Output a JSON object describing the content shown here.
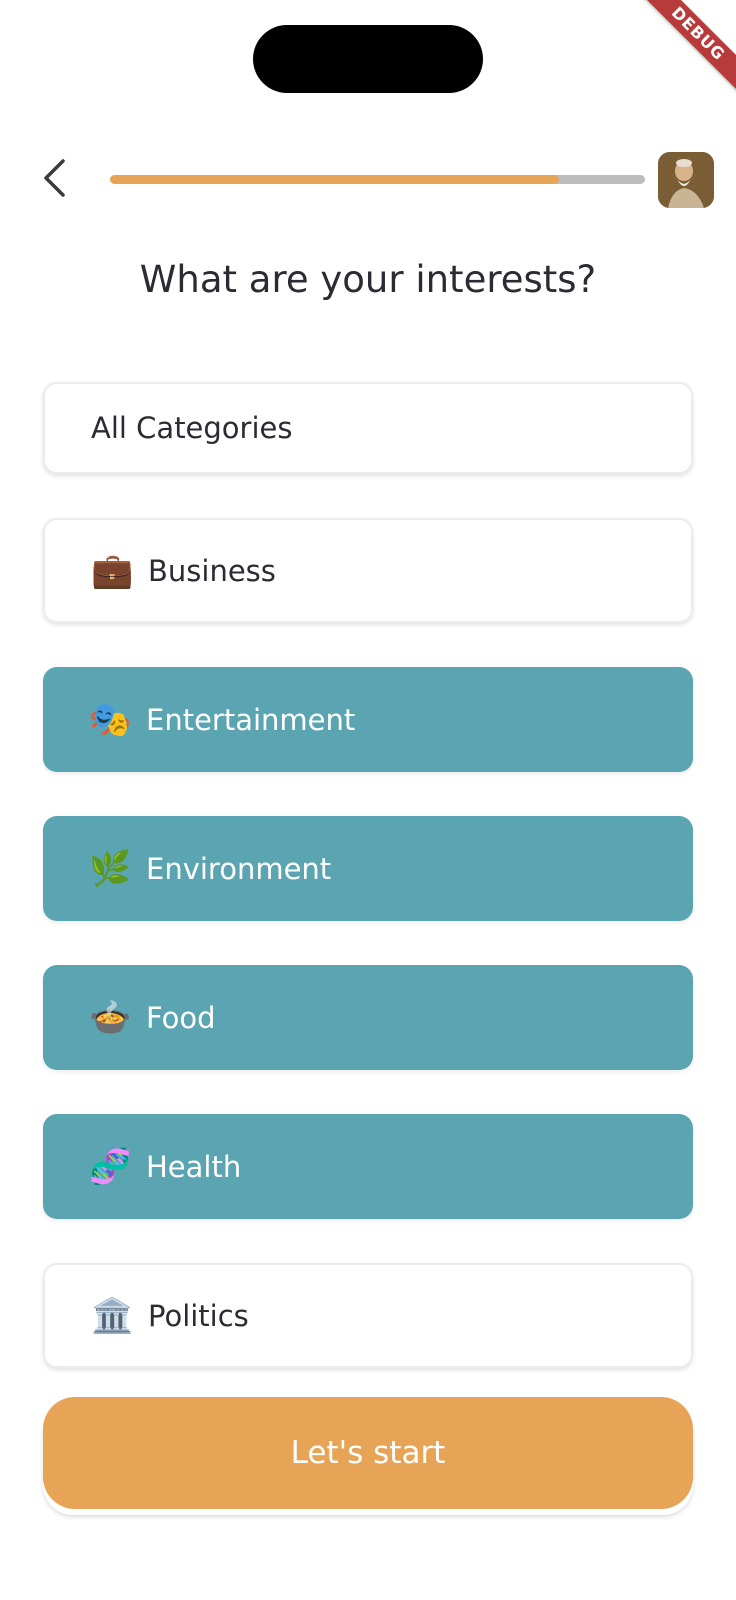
{
  "debug_banner": "DEBUG",
  "progress": 0.84,
  "header": {
    "title": "What are your interests?"
  },
  "categories": [
    {
      "label": "All Categories",
      "emoji": "",
      "selected": false
    },
    {
      "label": "Business",
      "emoji": "💼",
      "selected": false
    },
    {
      "label": "Entertainment",
      "emoji": "🎭",
      "selected": true
    },
    {
      "label": "Environment",
      "emoji": "🌿",
      "selected": true
    },
    {
      "label": "Food",
      "emoji": "🍲",
      "selected": true
    },
    {
      "label": "Health",
      "emoji": "🧬",
      "selected": true
    },
    {
      "label": "Politics",
      "emoji": "🏛️",
      "selected": false
    }
  ],
  "start_button_label": "Let's start",
  "colors": {
    "accent": "#e8a456",
    "selected": "#5ba5b2",
    "track": "#bdbdbd"
  }
}
